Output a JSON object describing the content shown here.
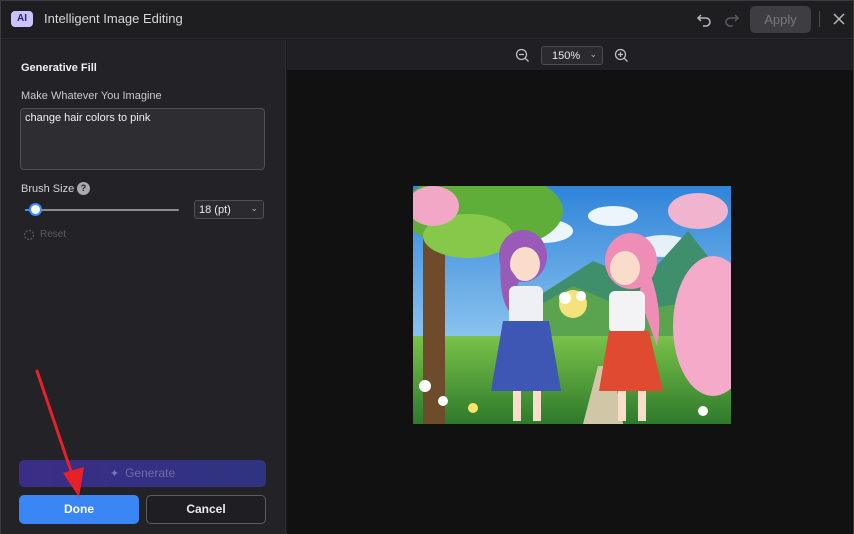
{
  "window": {
    "app_badge": "AI",
    "title": "Intelligent Image Editing",
    "apply_label": "Apply"
  },
  "left_panel": {
    "section_title": "Generative Fill",
    "prompt_label": "Make Whatever You Imagine",
    "prompt_value": "change hair colors to pink",
    "brush_size_label": "Brush Size",
    "help_glyph": "?",
    "brush_size_value": "18 (pt)",
    "brush_slider_fraction": 0.07,
    "reset_label": "Reset",
    "generate_label": "Generate",
    "done_label": "Done",
    "cancel_label": "Cancel"
  },
  "canvas": {
    "zoom_value": "150%"
  },
  "colors": {
    "accent": "#3b86f5",
    "annotation_arrow": "#e8202a"
  },
  "icons": {
    "undo": "undo-icon",
    "redo": "redo-icon",
    "close": "close-icon",
    "zoom_out": "zoom-out-icon",
    "zoom_in": "zoom-in-icon",
    "help": "help-icon",
    "reset": "reset-icon",
    "sparkle": "sparkle-icon",
    "chevron": "chevron-down-icon"
  }
}
